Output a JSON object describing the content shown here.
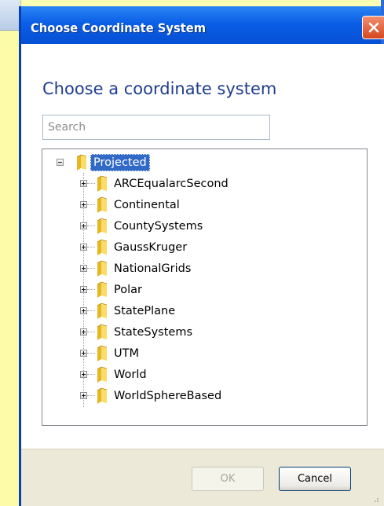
{
  "dialog": {
    "title": "Choose Coordinate System",
    "heading": "Choose a coordinate system"
  },
  "search": {
    "placeholder": "Search",
    "value": ""
  },
  "tree": {
    "root": {
      "label": "Projected",
      "expanded": true,
      "selected": true
    },
    "children": [
      {
        "label": "ARCEqualarcSecond"
      },
      {
        "label": "Continental"
      },
      {
        "label": "CountySystems"
      },
      {
        "label": "GaussKruger"
      },
      {
        "label": "NationalGrids"
      },
      {
        "label": "Polar"
      },
      {
        "label": "StatePlane"
      },
      {
        "label": "StateSystems"
      },
      {
        "label": "UTM"
      },
      {
        "label": "World"
      },
      {
        "label": "WorldSphereBased"
      }
    ]
  },
  "buttons": {
    "ok_label": "OK",
    "ok_enabled": false,
    "cancel_label": "Cancel"
  },
  "icons": {
    "close": "close-icon",
    "folder": "folder-icon",
    "expand": "expand-plus-icon",
    "collapse": "collapse-minus-icon"
  },
  "colors": {
    "titlebar": "#0a5ee6",
    "heading": "#1e3d8f",
    "selection": "#3169c6",
    "footer": "#ece9d8"
  }
}
